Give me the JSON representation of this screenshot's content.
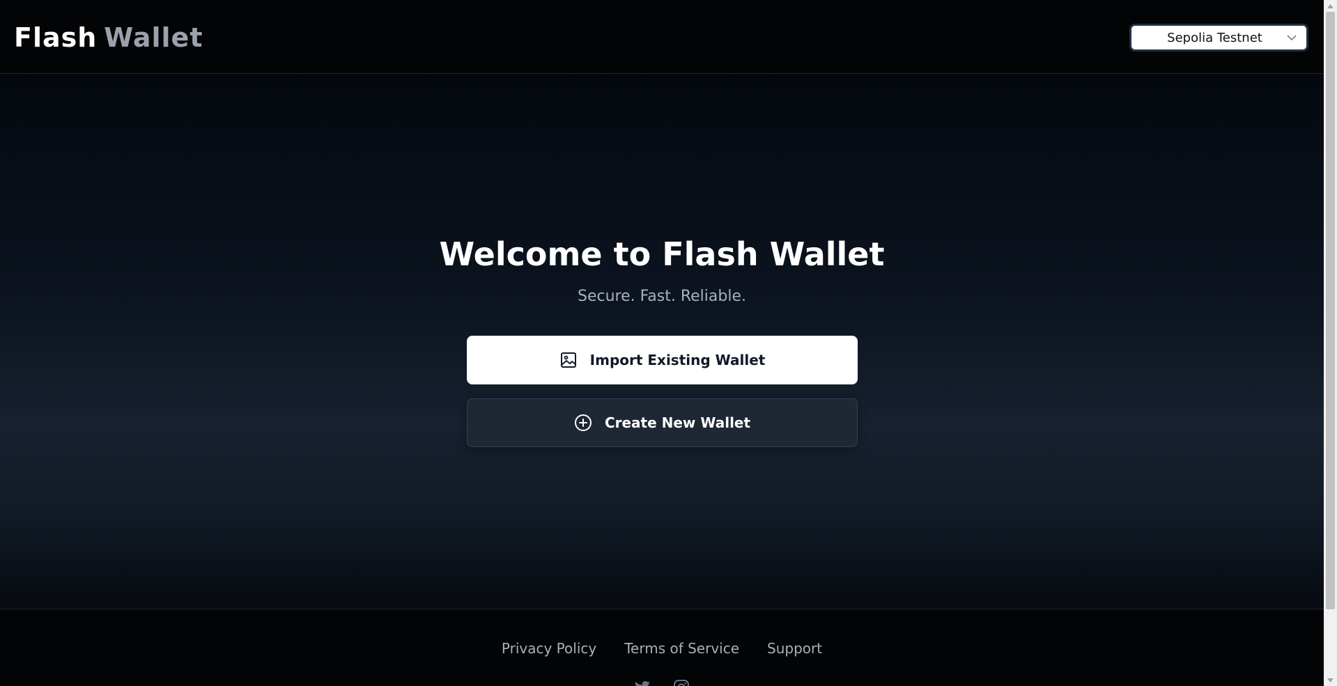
{
  "header": {
    "brand_part1": "Flash",
    "brand_part2": "Wallet",
    "network": {
      "selected": "Sepolia Testnet"
    }
  },
  "hero": {
    "title": "Welcome to Flash Wallet",
    "subtitle": "Secure. Fast. Reliable."
  },
  "actions": {
    "import_label": "Import Existing Wallet",
    "import_icon": "image-icon",
    "create_label": "Create New Wallet",
    "create_icon": "plus-circle-icon"
  },
  "footer": {
    "links": [
      "Privacy Policy",
      "Terms of Service",
      "Support"
    ],
    "socials": [
      "twitter-icon",
      "instagram-icon"
    ]
  },
  "colors": {
    "background_top": "#030406",
    "background_mid": "#17212f",
    "primary_button": "#ffffff",
    "secondary_button": "#1e2733",
    "muted_text": "#a8b0bd"
  }
}
